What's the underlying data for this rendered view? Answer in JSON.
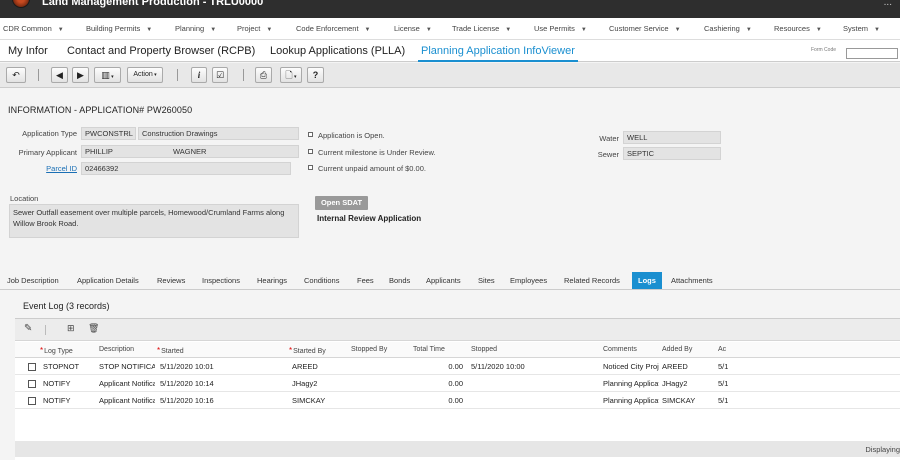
{
  "window": {
    "title": "Land Management Production - TRLU0000",
    "corner": "..."
  },
  "menu": [
    {
      "label": "CDR Common"
    },
    {
      "label": "Building Permits"
    },
    {
      "label": "Planning"
    },
    {
      "label": "Project"
    },
    {
      "label": "Code Enforcement"
    },
    {
      "label": "License"
    },
    {
      "label": "Trade License"
    },
    {
      "label": "Use Permits"
    },
    {
      "label": "Customer Service"
    },
    {
      "label": "Cashiering"
    },
    {
      "label": "Resources"
    },
    {
      "label": "System"
    }
  ],
  "app_tabs": [
    {
      "label": "My Infor"
    },
    {
      "label": "Contact and Property Browser (RCPB)"
    },
    {
      "label": "Lookup Applications (PLLA)"
    },
    {
      "label": "Planning Application InfoViewer",
      "active": true
    }
  ],
  "form_code": {
    "label": "Form Code",
    "value": ""
  },
  "toolbar": {
    "back_glyph": "↶",
    "prev_glyph": "◀",
    "next_glyph": "▶",
    "columns_glyph": "▥",
    "action_label": "Action",
    "info_glyph": "i",
    "check_glyph": "☑",
    "print_glyph": "⎙",
    "page_glyph": "🗋",
    "help_glyph": "?"
  },
  "heading": "INFORMATION - APPLICATION# PW260050",
  "fields": {
    "application_type_label": "Application Type",
    "application_type_code": "PWCONSTRL",
    "application_type_desc": "Construction Drawings",
    "primary_applicant_label": "Primary Applicant",
    "applicant_first": "PHILLIP",
    "applicant_last": "WAGNER",
    "parcel_label": "Parcel ID",
    "parcel_value": "02466392",
    "water_label": "Water",
    "water_value": "WELL",
    "sewer_label": "Sewer",
    "sewer_value": "SEPTIC",
    "location_label": "Location",
    "location_value": "Sewer Outfall easement over multiple parcels, Homewood/Crumland Farms along Willow Brook Road."
  },
  "status": {
    "open": "Application is Open.",
    "milestone": "Current milestone is Under Review.",
    "unpaid": "Current unpaid amount of $0.00."
  },
  "open_sdat_label": "Open SDAT",
  "review_label": "Internal Review Application",
  "detail_tabs": [
    {
      "label": "Job Description"
    },
    {
      "label": "Application Details"
    },
    {
      "label": "Reviews"
    },
    {
      "label": "Inspections"
    },
    {
      "label": "Hearings"
    },
    {
      "label": "Conditions"
    },
    {
      "label": "Fees"
    },
    {
      "label": "Bonds"
    },
    {
      "label": "Applicants"
    },
    {
      "label": "Sites"
    },
    {
      "label": "Employees"
    },
    {
      "label": "Related Records"
    },
    {
      "label": "Logs",
      "active": true
    },
    {
      "label": "Attachments"
    }
  ],
  "log": {
    "title": "Event Log (3 records)",
    "columns": {
      "log_type": "Log Type",
      "description": "Description",
      "started": "Started",
      "started_by": "Started By",
      "stopped_by": "Stopped By",
      "total_time": "Total Time",
      "stopped": "Stopped",
      "comments": "Comments",
      "added_by": "Added By",
      "ac": "Ac"
    },
    "rows": [
      {
        "log_type": "STOPNOT",
        "description": "STOP NOTIFICATION",
        "started": "5/11/2020 10:01",
        "started_by": "AREED",
        "stopped_by": "",
        "total_time": "0.00",
        "stopped": "5/11/2020 10:00",
        "comments": "Noticed City Project",
        "added_by": "AREED",
        "ac": "5/1"
      },
      {
        "log_type": "NOTIFY",
        "description": "Applicant Notification",
        "started": "5/11/2020 10:14",
        "started_by": "JHagy2",
        "stopped_by": "",
        "total_time": "0.00",
        "stopped": "",
        "comments": "Planning Application",
        "added_by": "JHagy2",
        "ac": "5/1"
      },
      {
        "log_type": "NOTIFY",
        "description": "Applicant Notification",
        "started": "5/11/2020 10:16",
        "started_by": "SIMCKAY",
        "stopped_by": "",
        "total_time": "0.00",
        "stopped": "",
        "comments": "Planning Application",
        "added_by": "SIMCKAY",
        "ac": "5/1"
      }
    ],
    "footer": "Displaying"
  },
  "colors": {
    "accent": "#1a8fd0",
    "topbar": "#2e2e2e",
    "field": "#e3e3e3"
  }
}
